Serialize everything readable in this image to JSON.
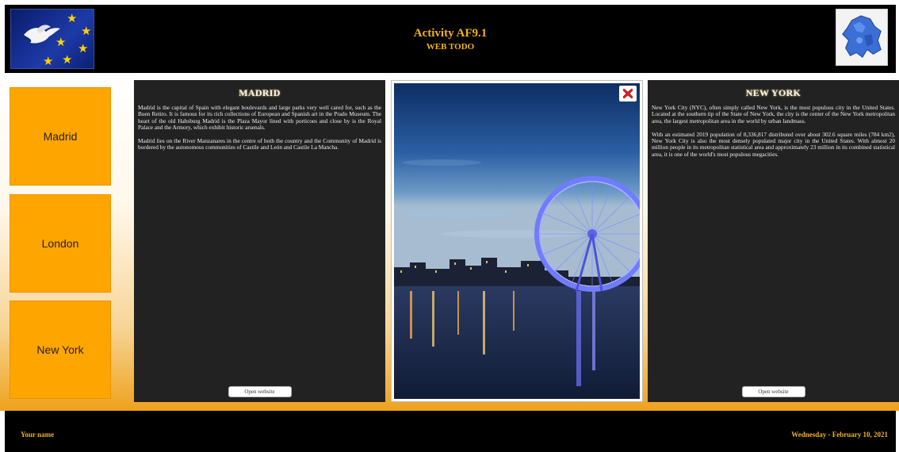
{
  "header": {
    "title": "Activity AF9.1",
    "subtitle": "WEB TODO",
    "left_logo_icon": "eu-flag-dove-icon",
    "right_logo_icon": "europe-map-icon"
  },
  "nav": {
    "items": [
      {
        "label": "Madrid"
      },
      {
        "label": "London"
      },
      {
        "label": "New York"
      }
    ]
  },
  "left_panel": {
    "title": "MADRID",
    "paragraphs": [
      "Madrid is the capital of Spain with elegant boulevards and large parks very well cared for, such as the Buen Retiro. It is famous for its rich collections of European and Spanish art in the Prado Museum. The heart of the old Habsburg Madrid is the Plaza Mayor lined with porticoes and close by is the Royal Palace and the Armory, which exhibit historic arsenals.",
      "Madrid lies on the River Manzanares in the centre of both the country and the Community of Madrid is bordered by the autonomous communities of Castile and León and Castile La Mancha."
    ],
    "button_label": "Open website"
  },
  "photo": {
    "close_icon": "close-icon"
  },
  "right_panel": {
    "title": "NEW YORK",
    "paragraphs": [
      "New York City (NYC), often simply called New York, is the most populous city in the United States. Located at the southern tip of the State of New York, the city is the center of the New York metropolitan area, the largest metropolitan area in the world by urban landmass.",
      "With an estimated 2019 population of 8,336,817 distributed over about 302.6 square miles (784 km2), New York City is also the most densely populated major city in the United States. With almost 20 million people in its metropolitan statistical area and approximately 23 million in its combined statistical area, it is one of the world's most populous megacities."
    ],
    "button_label": "Open website"
  },
  "footer": {
    "name": "Your name",
    "date": "Wednesday - February 10, 2021"
  },
  "colors": {
    "accent": "#ffa500",
    "header_text": "#f3b21b",
    "panel_bg": "#222222"
  }
}
